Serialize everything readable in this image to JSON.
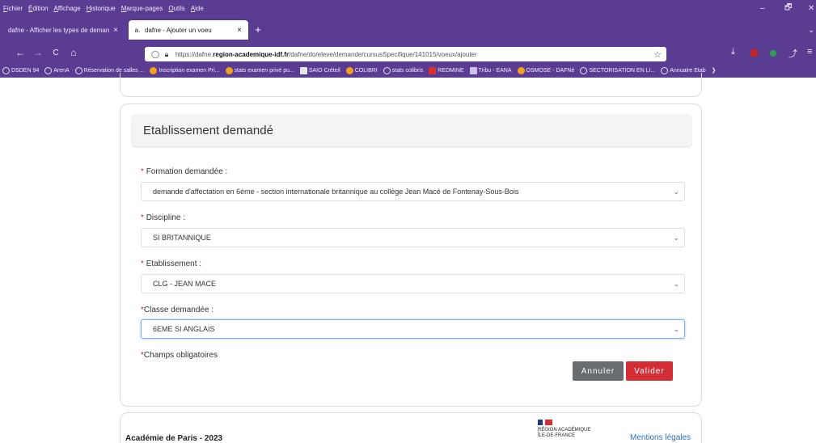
{
  "menubar": {
    "items": [
      "Fichier",
      "Édition",
      "Affichage",
      "Historique",
      "Marque-pages",
      "Outils",
      "Aide"
    ],
    "accels": [
      "F",
      "É",
      "A",
      "H",
      "M",
      "O",
      "A"
    ]
  },
  "window_controls": {
    "minimize": "–",
    "maximize": "🗗",
    "close": "✕"
  },
  "tabs": [
    {
      "title": "dafne - Afficher les types de deman",
      "favicon": "",
      "close": "×"
    },
    {
      "title": "dafne - Ajouter un voeu",
      "favicon": "a.",
      "close": "×"
    }
  ],
  "new_tab": "+",
  "tabs_dropdown": "⌄",
  "navbar": {
    "back": "←",
    "forward": "→",
    "reload": "C",
    "home": "⌂",
    "url_prefix": "https://dafne.",
    "url_domain": "region-academique-idf.fr",
    "url_path": "/dafne/do/eleve/demande/cursusSpecifique/141015/voeux/ajouter",
    "bookmark_star": "☆",
    "download_icon": "⤓",
    "extensions_icon": "⤴",
    "menu_icon": "≡"
  },
  "bookmarks": [
    {
      "label": "DSDEN 94",
      "icon": "globe"
    },
    {
      "label": "ArenA",
      "icon": "globe"
    },
    {
      "label": "Réservation de salles ...",
      "icon": "globe"
    },
    {
      "label": "Inscription examen Pri...",
      "icon": "face"
    },
    {
      "label": "stats examen privé pu...",
      "icon": "face"
    },
    {
      "label": "SAIO Créteil",
      "icon": "saio"
    },
    {
      "label": "COLIBRI",
      "icon": "face"
    },
    {
      "label": "stats colibris",
      "icon": "globe"
    },
    {
      "label": "REDMINE",
      "icon": "red"
    },
    {
      "label": "Tribu - EANA",
      "icon": "tribu"
    },
    {
      "label": "OSMOSE - DAFNé",
      "icon": "face"
    },
    {
      "label": "SECTORISATION EN LI...",
      "icon": "globe"
    },
    {
      "label": "Annuaire Etab",
      "icon": "globe"
    }
  ],
  "bookmarks_overflow": "❯",
  "form": {
    "title": "Etablissement demandé",
    "required_mark": "*",
    "fields": [
      {
        "label": "Formation demandée :",
        "value": "demande d'affectation en 6ème - section internationale britannique au collège Jean Macé de Fontenay-Sous-Bois"
      },
      {
        "label": "Discipline :",
        "value": "SI BRITANNIQUE"
      },
      {
        "label": "Etablissement :",
        "value": "CLG - JEAN MACE"
      },
      {
        "label": "Classe demandée :",
        "value": "6EME SI ANGLAIS"
      }
    ],
    "required_note": "Champs obligatoires",
    "cancel_label": "Annuler",
    "submit_label": "Valider",
    "chevron": "⌄"
  },
  "footer": {
    "academy": "Académie de Paris - 2023",
    "region_line1": "RÉGION ACADÉMIQUE",
    "region_line2": "ÎLE-DE-FRANCE",
    "legal": "Mentions légales"
  }
}
